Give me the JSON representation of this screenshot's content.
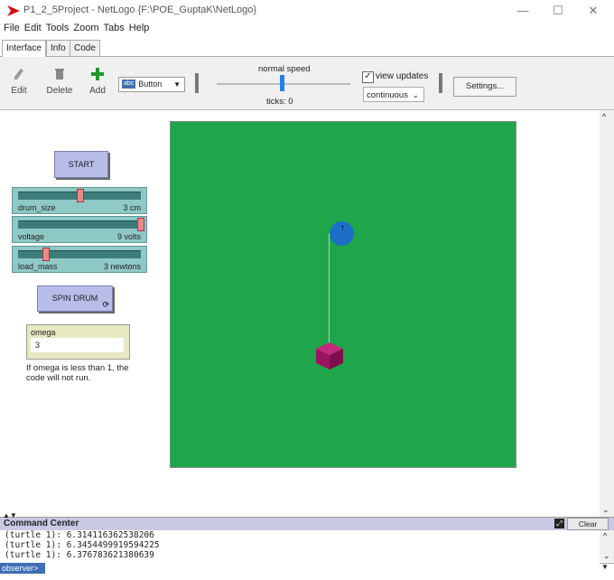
{
  "window": {
    "title": "P1_2_5Project - NetLogo {F:\\POE_GuptaK\\NetLogo}",
    "minimize_glyph": "—",
    "maximize_glyph": "☐",
    "close_glyph": "✕"
  },
  "menu": [
    "File",
    "Edit",
    "Tools",
    "Zoom",
    "Tabs",
    "Help"
  ],
  "tabs": [
    "Interface",
    "Info",
    "Code"
  ],
  "toolbar": {
    "edit_label": "Edit",
    "delete_label": "Delete",
    "add_label": "Add",
    "widget_type": "Button",
    "widget_type_icon_text": "abc",
    "speed_label": "normal speed",
    "ticks_label": "ticks: 0",
    "view_updates_label": "view updates",
    "view_updates_checked": true,
    "update_mode": "continuous",
    "settings_label": "Settings..."
  },
  "widgets": {
    "start_button": "START",
    "sliders": [
      {
        "name": "drum_size",
        "value": "3 cm",
        "fraction": 0.52
      },
      {
        "name": "voltage",
        "value": "9 volts",
        "fraction": 1.0
      },
      {
        "name": "load_mass",
        "value": "3 newtons",
        "fraction": 0.22
      }
    ],
    "spin_button": "SPIN DRUM",
    "monitor": {
      "label": "omega",
      "value": "3"
    },
    "note": "If omega is less than 1, the code will not run."
  },
  "world": {
    "background_color": "#1fa64b",
    "drum_color": "#1c6ec7",
    "load_color": "#9c1560"
  },
  "command_center": {
    "title": "Command Center",
    "clear_label": "Clear",
    "output_lines": [
      "(turtle 1): 6.314116362538206",
      "(turtle 1): 6.3454499919594225",
      "(turtle 1): 6.376783621380639"
    ],
    "agent": "observer>"
  }
}
